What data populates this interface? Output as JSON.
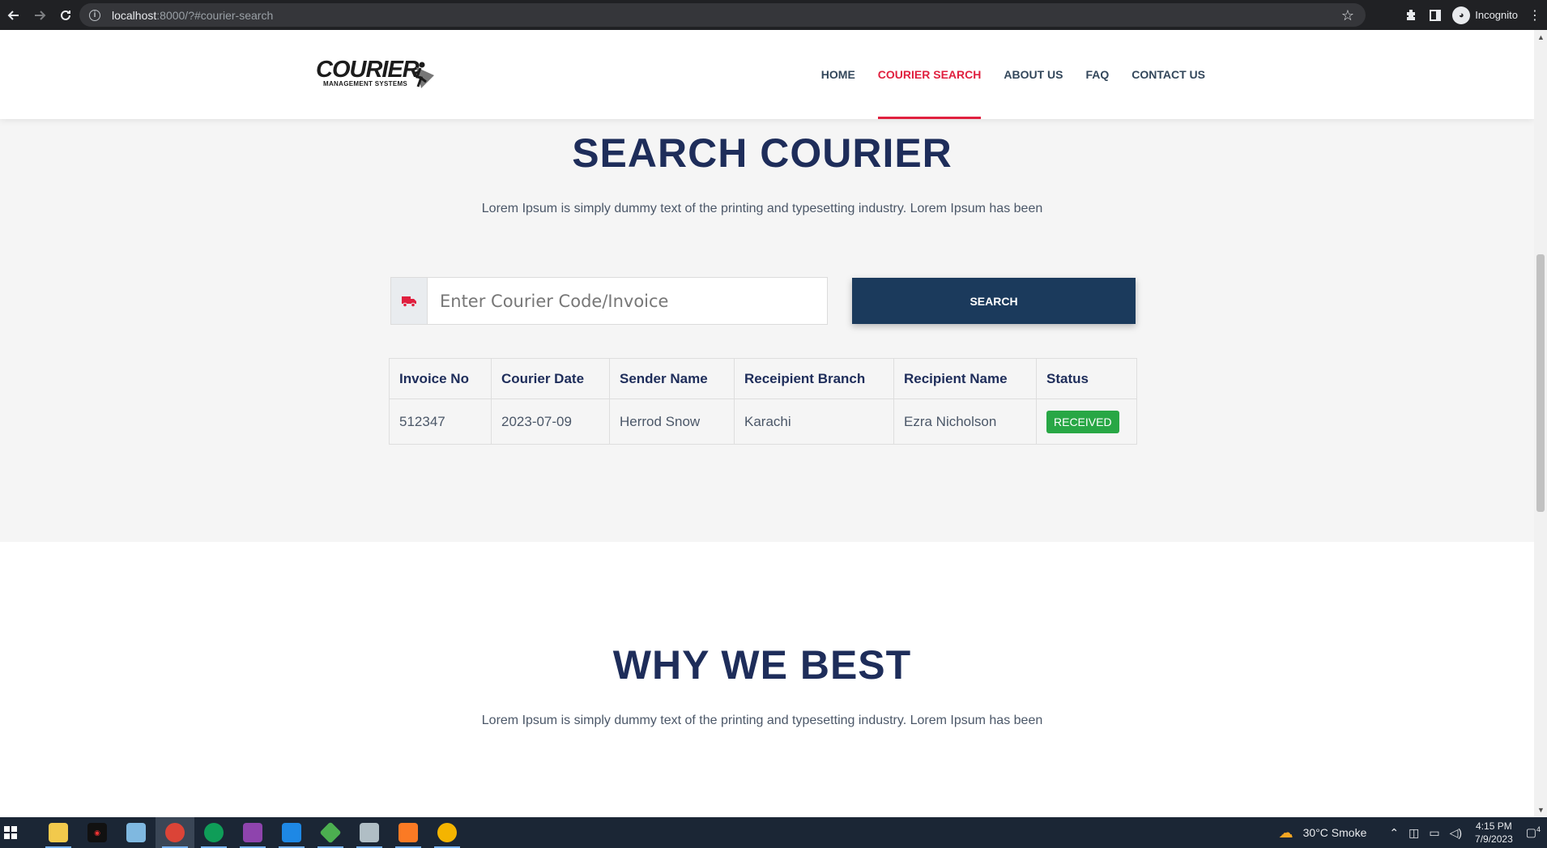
{
  "browser": {
    "url_host": "localhost",
    "url_path": ":8000/?#courier-search",
    "profile_label": "Incognito"
  },
  "header": {
    "logo_text": "COURIER",
    "logo_subtext": "MANAGEMENT SYSTEMS",
    "nav": [
      {
        "label": "HOME",
        "active": false
      },
      {
        "label": "COURIER SEARCH",
        "active": true
      },
      {
        "label": "ABOUT US",
        "active": false
      },
      {
        "label": "FAQ",
        "active": false
      },
      {
        "label": "CONTACT US",
        "active": false
      }
    ]
  },
  "search_section": {
    "title": "SEARCH COURIER",
    "description": "Lorem Ipsum is simply dummy text of the printing and typesetting industry. Lorem Ipsum has been",
    "input_placeholder": "Enter Courier Code/Invoice",
    "input_value": "",
    "input_icon": "truck-icon",
    "button_label": "SEARCH"
  },
  "results_table": {
    "headers": [
      "Invoice No",
      "Courier Date",
      "Sender Name",
      "Receipient Branch",
      "Recipient Name",
      "Status"
    ],
    "rows": [
      {
        "invoice_no": "512347",
        "courier_date": "2023-07-09",
        "sender_name": "Herrod Snow",
        "recipient_branch": "Karachi",
        "recipient_name": "Ezra Nicholson",
        "status": "RECEIVED"
      }
    ]
  },
  "why_section": {
    "title": "WHY WE BEST",
    "description": "Lorem Ipsum is simply dummy text of the printing and typesetting industry. Lorem Ipsum has been"
  },
  "taskbar": {
    "weather": "30°C  Smoke",
    "time": "4:15 PM",
    "date": "7/9/2023",
    "notification_count": "4"
  },
  "colors": {
    "brand_navy": "#1e2d5a",
    "button_navy": "#1b3a5c",
    "accent_red": "#e0203f",
    "status_green": "#28a745"
  }
}
